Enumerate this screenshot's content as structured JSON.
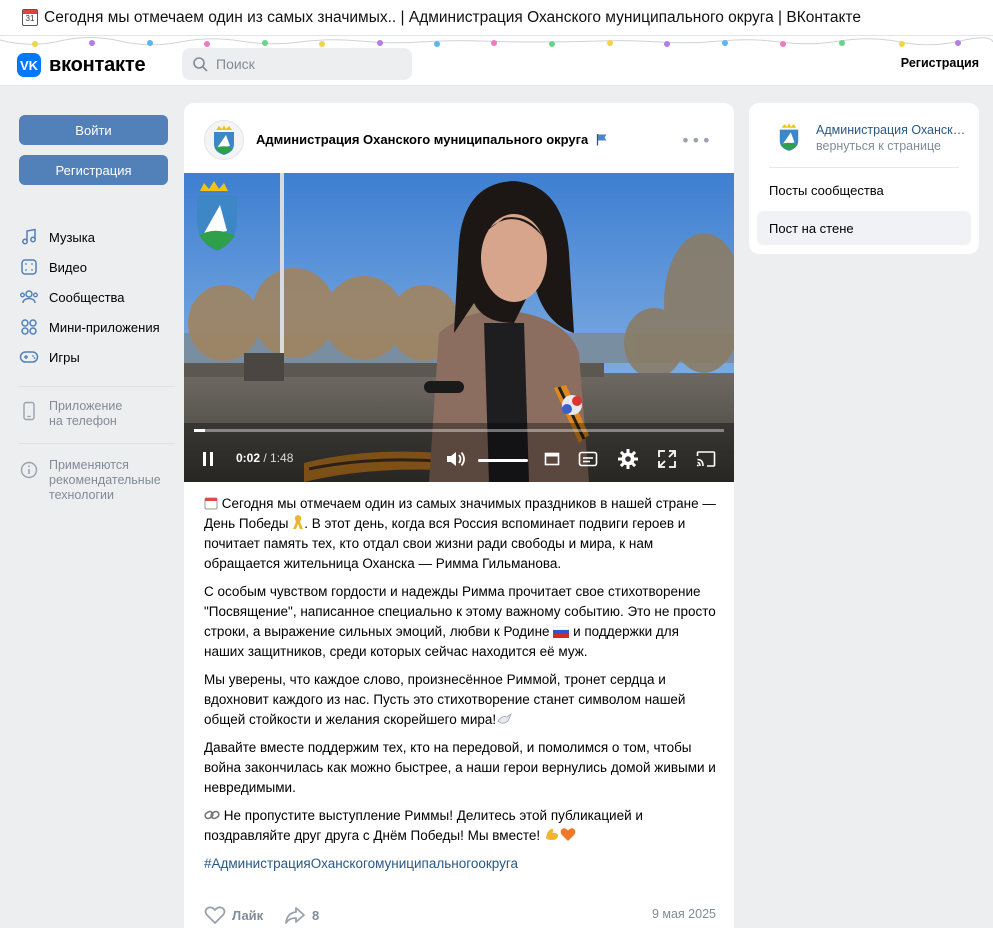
{
  "window": {
    "tab_title": "Сегодня мы отмечаем один из самых значимых.. | Администрация Оханского муниципального округа | ВКонтакте",
    "calendar_day": "31"
  },
  "header": {
    "logo_mark": "VK",
    "logo_word": "вконтакте",
    "search_placeholder": "Поиск",
    "register_link": "Регистрация"
  },
  "sidebar": {
    "login_button": "Войти",
    "register_button": "Регистрация",
    "nav": [
      {
        "label": "Музыка",
        "icon": "music-icon"
      },
      {
        "label": "Видео",
        "icon": "video-icon"
      },
      {
        "label": "Сообщества",
        "icon": "communities-icon"
      },
      {
        "label": "Мини-приложения",
        "icon": "mini-apps-icon"
      },
      {
        "label": "Игры",
        "icon": "gamepad-icon"
      }
    ],
    "app_note_line1": "Приложение",
    "app_note_line2": "на телефон",
    "rec_note_line1": "Применяются",
    "rec_note_line2": "рекомендательные",
    "rec_note_line3": "технологии"
  },
  "post": {
    "author": "Администрация Оханского муниципального округа",
    "video": {
      "current_time": "0:02",
      "separator": " / ",
      "duration": "1:48",
      "progress": 0.02
    },
    "paragraphs": {
      "p1a": " Сегодня мы отмечаем один из самых значимых праздников в нашей стране — День Победы",
      "p1b": ". В этот день, когда вся Россия вспоминает подвиги героев и почитает память тех, кто отдал свои жизни ради свободы и мира, к нам обращается жительница Оханска — Римма Гильманова.",
      "p2a": "С особым чувством гордости и надежды Римма прочитает свое стихотворение \"Посвящение\", написанное специально к этому важному событию. Это не просто строки, а выражение сильных эмоций, любви к Родине",
      "p2b": " и поддержки для наших защитников, среди которых сейчас находится её муж.",
      "p3": "Мы уверены, что каждое слово, произнесённое Риммой, тронет сердца и вдохновит каждого из нас. Пусть это стихотворение станет символом нашей общей стойкости и желания скорейшего мира!",
      "p4": "Давайте вместе поддержим тех, кто на передовой, и помолимся о том, чтобы война закончилась как можно быстрее, а наши герои вернулись домой живыми и невредимыми.",
      "p5": " Не пропустите выступление Риммы! Делитесь этой публикацией и поздравляйте друг друга с Днём Победы! Мы вместе! "
    },
    "hashtag": "#АдминистрацияОханскогомуниципальногоокруга",
    "like_label": "Лайк",
    "share_count": "8",
    "date": "9 мая 2025"
  },
  "right_panel": {
    "group_name": "Администрация Оханского муниципального округа",
    "back_link": "вернуться к странице",
    "items": [
      "Посты сообщества",
      "Пост на стене"
    ]
  },
  "colors": {
    "accent": "#0077ff",
    "button": "#5181b8",
    "link": "#2a5885",
    "muted": "#818c99"
  }
}
